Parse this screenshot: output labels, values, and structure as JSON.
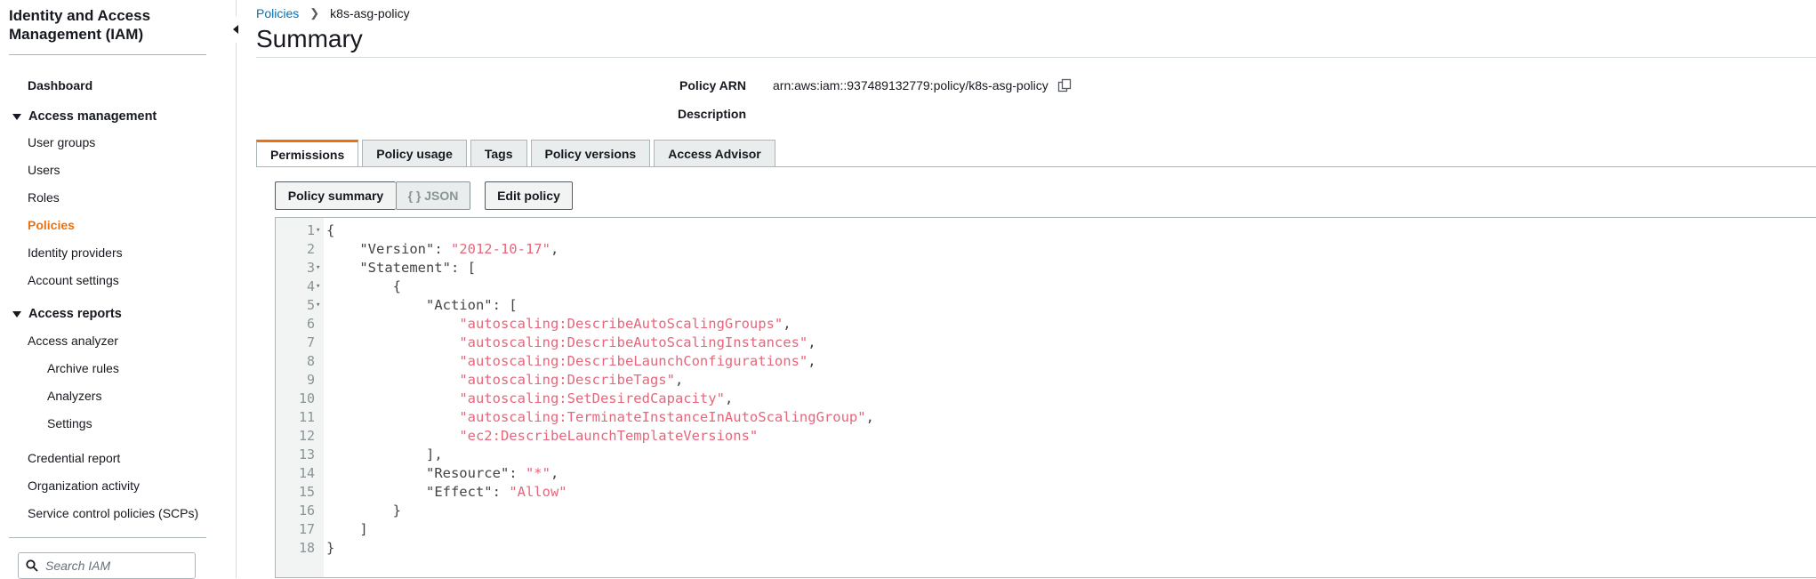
{
  "sidebar": {
    "title": "Identity and Access Management (IAM)",
    "dashboard": "Dashboard",
    "access_management": {
      "label": "Access management",
      "items": [
        "User groups",
        "Users",
        "Roles",
        "Policies",
        "Identity providers",
        "Account settings"
      ]
    },
    "access_reports": {
      "label": "Access reports",
      "items": [
        "Access analyzer"
      ],
      "subitems": [
        "Archive rules",
        "Analyzers",
        "Settings"
      ],
      "more_items": [
        "Credential report",
        "Organization activity",
        "Service control policies (SCPs)"
      ]
    },
    "search_placeholder": "Search IAM",
    "active_item": "Policies"
  },
  "breadcrumb": {
    "parent": "Policies",
    "current": "k8s-asg-policy"
  },
  "page_title": "Summary",
  "policy": {
    "arn_label": "Policy ARN",
    "arn_value": "arn:aws:iam::937489132779:policy/k8s-asg-policy",
    "description_label": "Description",
    "description_value": ""
  },
  "tabs": [
    "Permissions",
    "Policy usage",
    "Tags",
    "Policy versions",
    "Access Advisor"
  ],
  "selected_tab": "Permissions",
  "buttons": {
    "policy_summary": "Policy summary",
    "json": "{ } JSON",
    "edit_policy": "Edit policy"
  },
  "editor": {
    "lines": [
      {
        "n": "1",
        "fold": true,
        "indent": 0,
        "parts": [
          {
            "t": "{"
          }
        ]
      },
      {
        "n": "2",
        "fold": false,
        "indent": 4,
        "parts": [
          {
            "t": "\"Version\": "
          },
          {
            "t": "\"2012-10-17\"",
            "s": true
          },
          {
            "t": ","
          }
        ]
      },
      {
        "n": "3",
        "fold": true,
        "indent": 4,
        "parts": [
          {
            "t": "\"Statement\": ["
          }
        ]
      },
      {
        "n": "4",
        "fold": true,
        "indent": 8,
        "parts": [
          {
            "t": "{"
          }
        ]
      },
      {
        "n": "5",
        "fold": true,
        "indent": 12,
        "parts": [
          {
            "t": "\"Action\": ["
          }
        ]
      },
      {
        "n": "6",
        "fold": false,
        "indent": 16,
        "parts": [
          {
            "t": "\"autoscaling:DescribeAutoScalingGroups\"",
            "s": true
          },
          {
            "t": ","
          }
        ]
      },
      {
        "n": "7",
        "fold": false,
        "indent": 16,
        "parts": [
          {
            "t": "\"autoscaling:DescribeAutoScalingInstances\"",
            "s": true
          },
          {
            "t": ","
          }
        ]
      },
      {
        "n": "8",
        "fold": false,
        "indent": 16,
        "parts": [
          {
            "t": "\"autoscaling:DescribeLaunchConfigurations\"",
            "s": true
          },
          {
            "t": ","
          }
        ]
      },
      {
        "n": "9",
        "fold": false,
        "indent": 16,
        "parts": [
          {
            "t": "\"autoscaling:DescribeTags\"",
            "s": true
          },
          {
            "t": ","
          }
        ]
      },
      {
        "n": "10",
        "fold": false,
        "indent": 16,
        "parts": [
          {
            "t": "\"autoscaling:SetDesiredCapacity\"",
            "s": true
          },
          {
            "t": ","
          }
        ]
      },
      {
        "n": "11",
        "fold": false,
        "indent": 16,
        "parts": [
          {
            "t": "\"autoscaling:TerminateInstanceInAutoScalingGroup\"",
            "s": true
          },
          {
            "t": ","
          }
        ]
      },
      {
        "n": "12",
        "fold": false,
        "indent": 16,
        "parts": [
          {
            "t": "\"ec2:DescribeLaunchTemplateVersions\"",
            "s": true
          }
        ]
      },
      {
        "n": "13",
        "fold": false,
        "indent": 12,
        "parts": [
          {
            "t": "],"
          }
        ]
      },
      {
        "n": "14",
        "fold": false,
        "indent": 12,
        "parts": [
          {
            "t": "\"Resource\": "
          },
          {
            "t": "\"*\"",
            "s": true
          },
          {
            "t": ","
          }
        ]
      },
      {
        "n": "15",
        "fold": false,
        "indent": 12,
        "parts": [
          {
            "t": "\"Effect\": "
          },
          {
            "t": "\"Allow\"",
            "s": true
          }
        ]
      },
      {
        "n": "16",
        "fold": false,
        "indent": 8,
        "parts": [
          {
            "t": "}"
          }
        ]
      },
      {
        "n": "17",
        "fold": false,
        "indent": 4,
        "parts": [
          {
            "t": "]"
          }
        ]
      },
      {
        "n": "18",
        "fold": false,
        "indent": 0,
        "parts": [
          {
            "t": "}"
          }
        ]
      }
    ]
  },
  "colors": {
    "accent": "#ec7211",
    "link": "#0073bb",
    "json_string": "#e5677b"
  }
}
